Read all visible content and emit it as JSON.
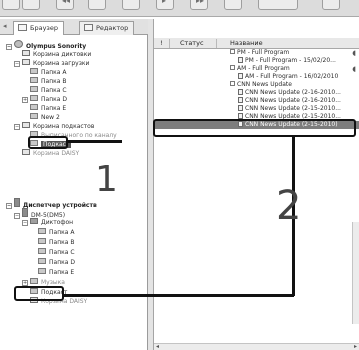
{
  "tabs": [
    {
      "label": "Браузер",
      "active": true
    },
    {
      "label": "Редактор",
      "active": false
    }
  ],
  "tree": [
    {
      "label": "Olympus Sonority",
      "bold": true
    },
    {
      "label": "Корзина диктовки"
    },
    {
      "label": "Корзина загрузки"
    },
    {
      "label": "Папка A"
    },
    {
      "label": "Папка B"
    },
    {
      "label": "Папка C"
    },
    {
      "label": "Папка D"
    },
    {
      "label": "Папка E"
    },
    {
      "label": "New 2"
    },
    {
      "label": "Корзина подкастов"
    },
    {
      "label": "Выписанного по каналу",
      "faded": true
    },
    {
      "label": "Подкаст",
      "selected": true
    },
    {
      "label": "Корзина DAISY",
      "faded": true
    },
    {
      "label": "Диспетчер устройств",
      "bold": true
    },
    {
      "label": "DM-5(DM5)"
    },
    {
      "label": "Диктофон"
    },
    {
      "label": "Папка A"
    },
    {
      "label": "Папка B"
    },
    {
      "label": "Папка C"
    },
    {
      "label": "Папка D"
    },
    {
      "label": "Папка E"
    },
    {
      "label": "Музыка",
      "faded": true
    },
    {
      "label": "Подкаст"
    },
    {
      "label": "Корзина DAISY",
      "faded": true
    }
  ],
  "list": {
    "columns": [
      "!",
      "Статус",
      "Название"
    ],
    "rows": [
      {
        "kind": "group",
        "text": "PM - Full Program"
      },
      {
        "kind": "file",
        "text": "PM - Full Program - 15/02/20..."
      },
      {
        "kind": "group",
        "text": "AM - Full Program"
      },
      {
        "kind": "file",
        "text": "AM - Full Program - 16/02/2010"
      },
      {
        "kind": "group",
        "text": "CNN News Update"
      },
      {
        "kind": "file",
        "text": "CNN News Update (2-16-2010..."
      },
      {
        "kind": "file",
        "text": "CNN News Update (2-16-2010..."
      },
      {
        "kind": "file",
        "text": "CNN News Update (2-15-2010..."
      },
      {
        "kind": "file",
        "text": "CNN News Update (2-15-2010..."
      },
      {
        "kind": "file",
        "text": "CNN News Update (2-15-2010)",
        "selected": true
      }
    ]
  },
  "callouts": [
    "1",
    "2"
  ],
  "icons": {
    "tab_arrow": "◂",
    "collapse": "−",
    "expand": "+",
    "scroll_left": "◂",
    "scroll_right": "▸",
    "row_tail": "◖"
  }
}
